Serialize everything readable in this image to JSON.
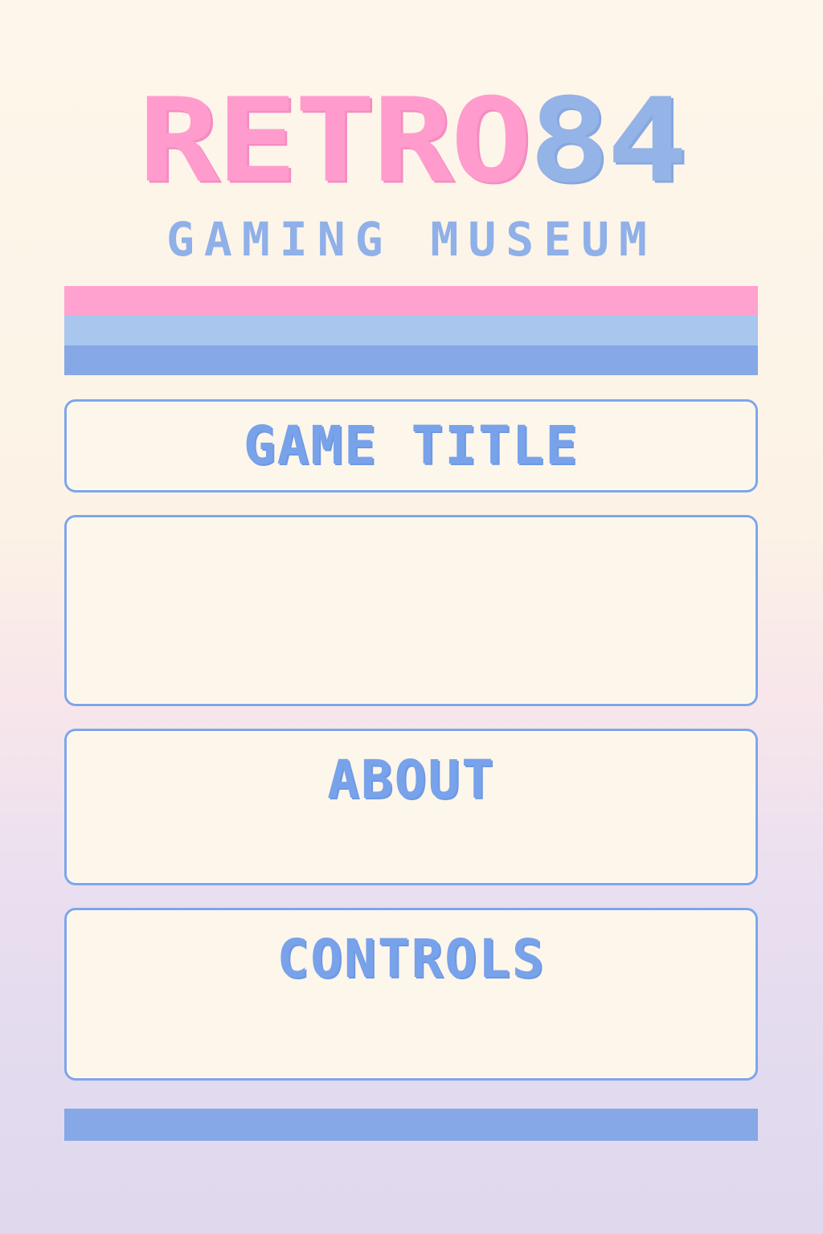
{
  "header": {
    "logo_part1": "RETRO",
    "logo_part2": "84",
    "subtitle": "GAMING MUSEUM"
  },
  "menu": {
    "title_label": "GAME TITLE",
    "about_label": "ABOUT",
    "controls_label": "CONTROLS"
  },
  "colors": {
    "pink": "#ff9ccd",
    "light_blue": "#a8c6ee",
    "blue": "#86a8e6",
    "cream": "#fdf6ea"
  }
}
